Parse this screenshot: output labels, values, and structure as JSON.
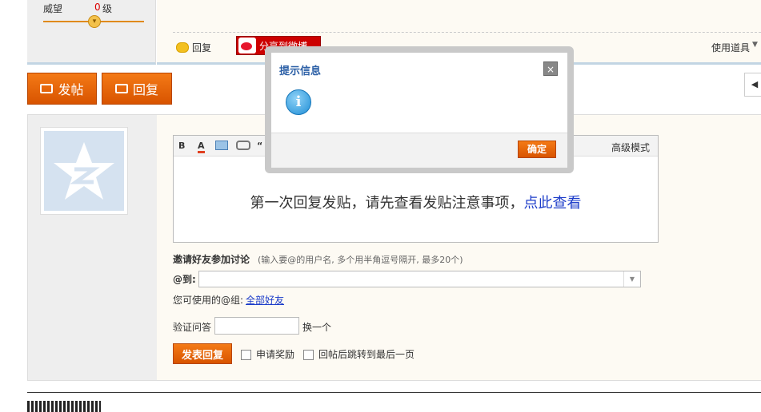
{
  "post": {
    "reputation_label": "威望",
    "reputation_value": "0",
    "reputation_unit": "级",
    "reply_label": "回复",
    "share_weibo_label": "分享到微博",
    "tools_label": "使用道具"
  },
  "actions": {
    "new_post_label": "发帖",
    "reply_label": "回复"
  },
  "editor": {
    "toolbar": [
      "B",
      "A",
      "“"
    ],
    "advanced_mode_label": "高级模式",
    "notice_text": "第一次回复发贴，请先查看发贴注意事项，",
    "notice_link": "点此查看"
  },
  "invite": {
    "title": "邀请好友参加讨论",
    "hint": "(输入要@的用户名, 多个用半角逗号隔开, 最多20个)",
    "at_label": "@到:",
    "groups_label": "您可使用的@组:",
    "groups_link": "全部好友"
  },
  "verify": {
    "label": "验证问答",
    "change_label": "换一个"
  },
  "submit": {
    "label": "发表回复",
    "reward_label": "申请奖励",
    "jump_last_label": "回帖后跳转到最后一页"
  },
  "dialog": {
    "title": "提示信息",
    "close_label": "×",
    "ok_label": "确定"
  },
  "colors": {
    "accent_orange": "#e86a0a",
    "link_blue": "#1c3cc9",
    "dialog_title_blue": "#2b5fa6"
  }
}
